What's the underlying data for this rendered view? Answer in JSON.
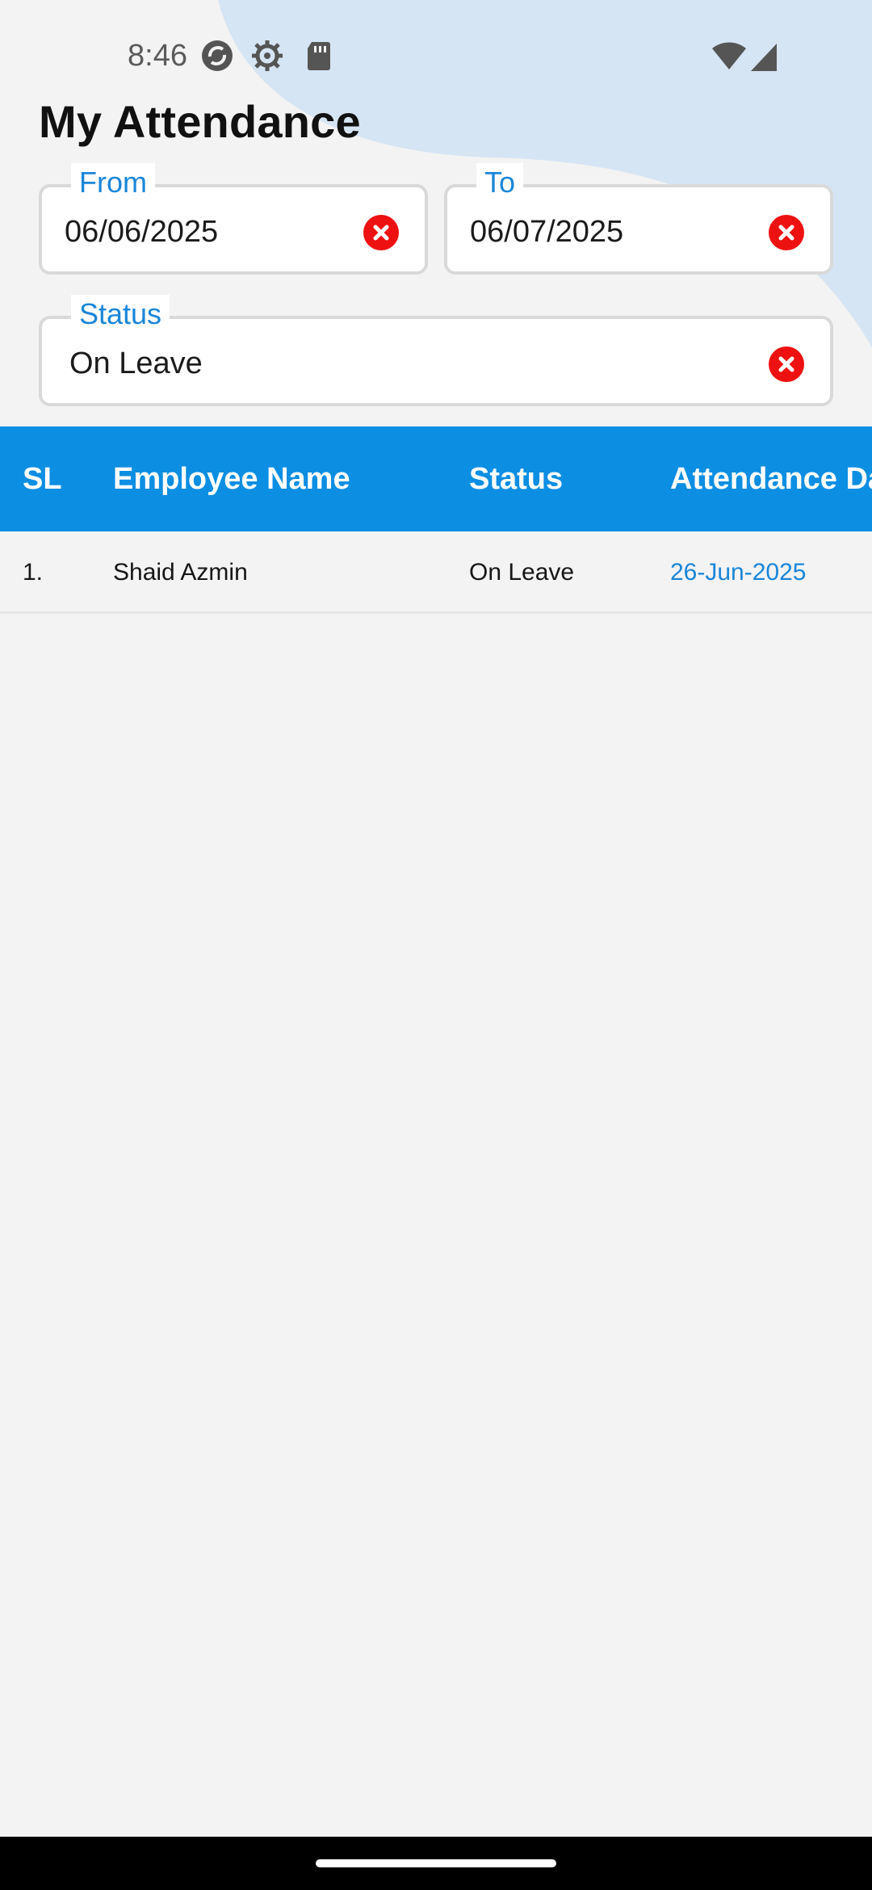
{
  "status_bar": {
    "time": "8:46",
    "icons": [
      "sync-icon",
      "gear-icon",
      "sd-card-icon"
    ],
    "right_icons": [
      "wifi-icon",
      "cellular-signal-icon"
    ]
  },
  "page": {
    "title": "My Attendance"
  },
  "filters": {
    "from": {
      "label": "From",
      "value": "06/06/2025"
    },
    "to": {
      "label": "To",
      "value": "06/07/2025"
    },
    "status": {
      "label": "Status",
      "value": "On Leave"
    }
  },
  "table": {
    "headers": [
      "SL",
      "Employee Name",
      "Status",
      "Attendance Da"
    ],
    "rows": [
      {
        "sl": "1.",
        "name": "Shaid Azmin",
        "status": "On Leave",
        "date": "26-Jun-2025"
      }
    ]
  },
  "colors": {
    "accent": "#1a86d8",
    "header_bg": "#0c8ee3",
    "clear_red": "#ee1111",
    "blob": "#d6e5f4"
  }
}
